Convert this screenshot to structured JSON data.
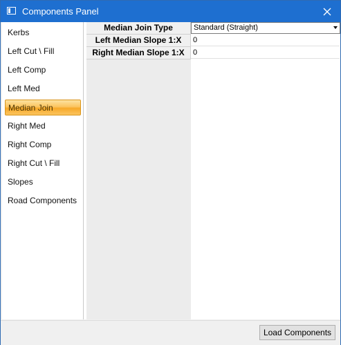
{
  "window": {
    "title": "Components Panel",
    "icon": "window-app-icon",
    "close_icon": "close-icon"
  },
  "sidebar": {
    "items": [
      {
        "label": "Kerbs"
      },
      {
        "label": "Left Cut \\ Fill"
      },
      {
        "label": "Left Comp"
      },
      {
        "label": "Left Med"
      },
      {
        "label": "Median Join",
        "selected": true
      },
      {
        "label": "Right Med"
      },
      {
        "label": "Right Comp"
      },
      {
        "label": "Right Cut \\ Fill"
      },
      {
        "label": "Slopes"
      },
      {
        "label": "Road Components"
      }
    ]
  },
  "properties": {
    "rows": [
      {
        "label": "Median Join Type",
        "value": "Standard (Straight)",
        "type": "dropdown"
      },
      {
        "label": "Left Median Slope 1:X",
        "value": "0",
        "type": "text"
      },
      {
        "label": "Right Median Slope 1:X",
        "value": "0",
        "type": "text"
      }
    ]
  },
  "footer": {
    "load_button": "Load Components"
  },
  "colors": {
    "titlebar": "#1e6fd0",
    "selected_item": "#f7a928"
  }
}
